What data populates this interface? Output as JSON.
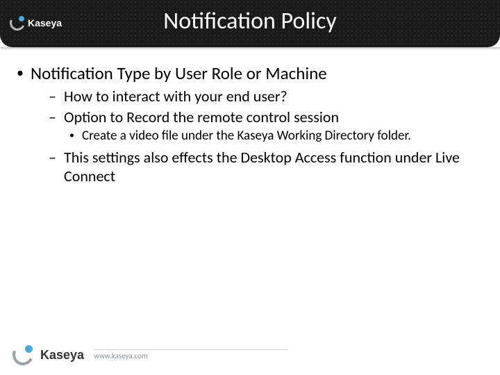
{
  "brand": {
    "name": "Kaseya",
    "url": "www.kaseya.com"
  },
  "slide": {
    "title": "Notification Policy",
    "bullets": {
      "l1_0": "Notification Type by User Role or Machine",
      "l2_0": "How to interact with your end user?",
      "l2_1": "Option to Record the remote control session",
      "l3_0": "Create a video file under the Kaseya Working Directory folder.",
      "l2_2": "This settings also effects the Desktop Access function under Live Connect"
    }
  }
}
